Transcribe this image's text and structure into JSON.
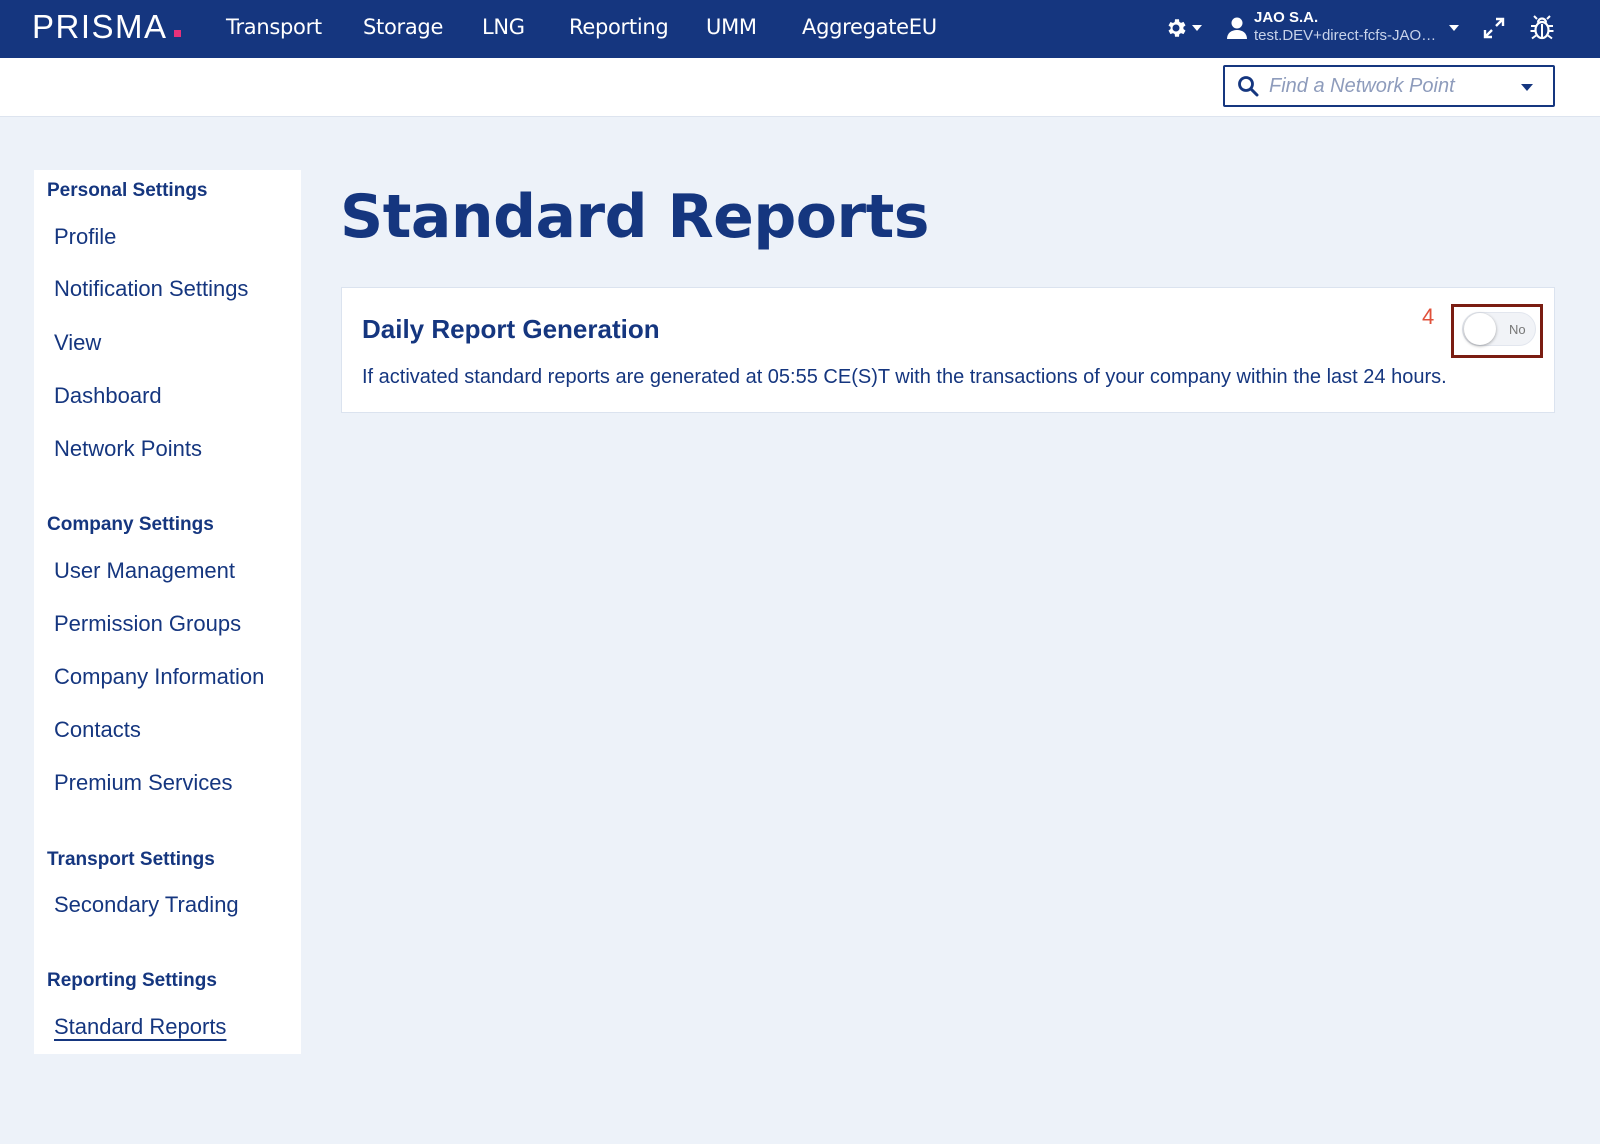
{
  "brand": {
    "logo_text": "PRISMA",
    "accent": "#e6317a",
    "primary": "#15367f"
  },
  "nav": {
    "items": [
      {
        "label": "Transport"
      },
      {
        "label": "Storage"
      },
      {
        "label": "LNG"
      },
      {
        "label": "Reporting"
      },
      {
        "label": "UMM"
      },
      {
        "label": "AggregateEU"
      }
    ],
    "icons": [
      "gear-icon",
      "user-icon",
      "expand-icon",
      "bug-icon"
    ],
    "user": {
      "company": "JAO S.A.",
      "email": "test.DEV+direct-fcfs-JAO…"
    }
  },
  "search": {
    "placeholder": "Find a Network Point",
    "value": ""
  },
  "sidebar": {
    "sections": [
      {
        "heading": "Personal Settings",
        "items": [
          "Profile",
          "Notification Settings",
          "View",
          "Dashboard",
          "Network Points"
        ]
      },
      {
        "heading": "Company Settings",
        "items": [
          "User Management",
          "Permission Groups",
          "Company Information",
          "Contacts",
          "Premium Services"
        ]
      },
      {
        "heading": "Transport Settings",
        "items": [
          "Secondary Trading"
        ]
      },
      {
        "heading": "Reporting Settings",
        "items": [
          "Standard Reports"
        ]
      }
    ],
    "active": "Standard Reports"
  },
  "main": {
    "title": "Standard Reports",
    "card": {
      "title": "Daily Report Generation",
      "description": "If activated standard reports are generated at 05:55 CE(S)T with the transactions of your company within the last 24 hours.",
      "toggle_label": "No",
      "toggle_on": false,
      "annotation_number": "4"
    }
  }
}
